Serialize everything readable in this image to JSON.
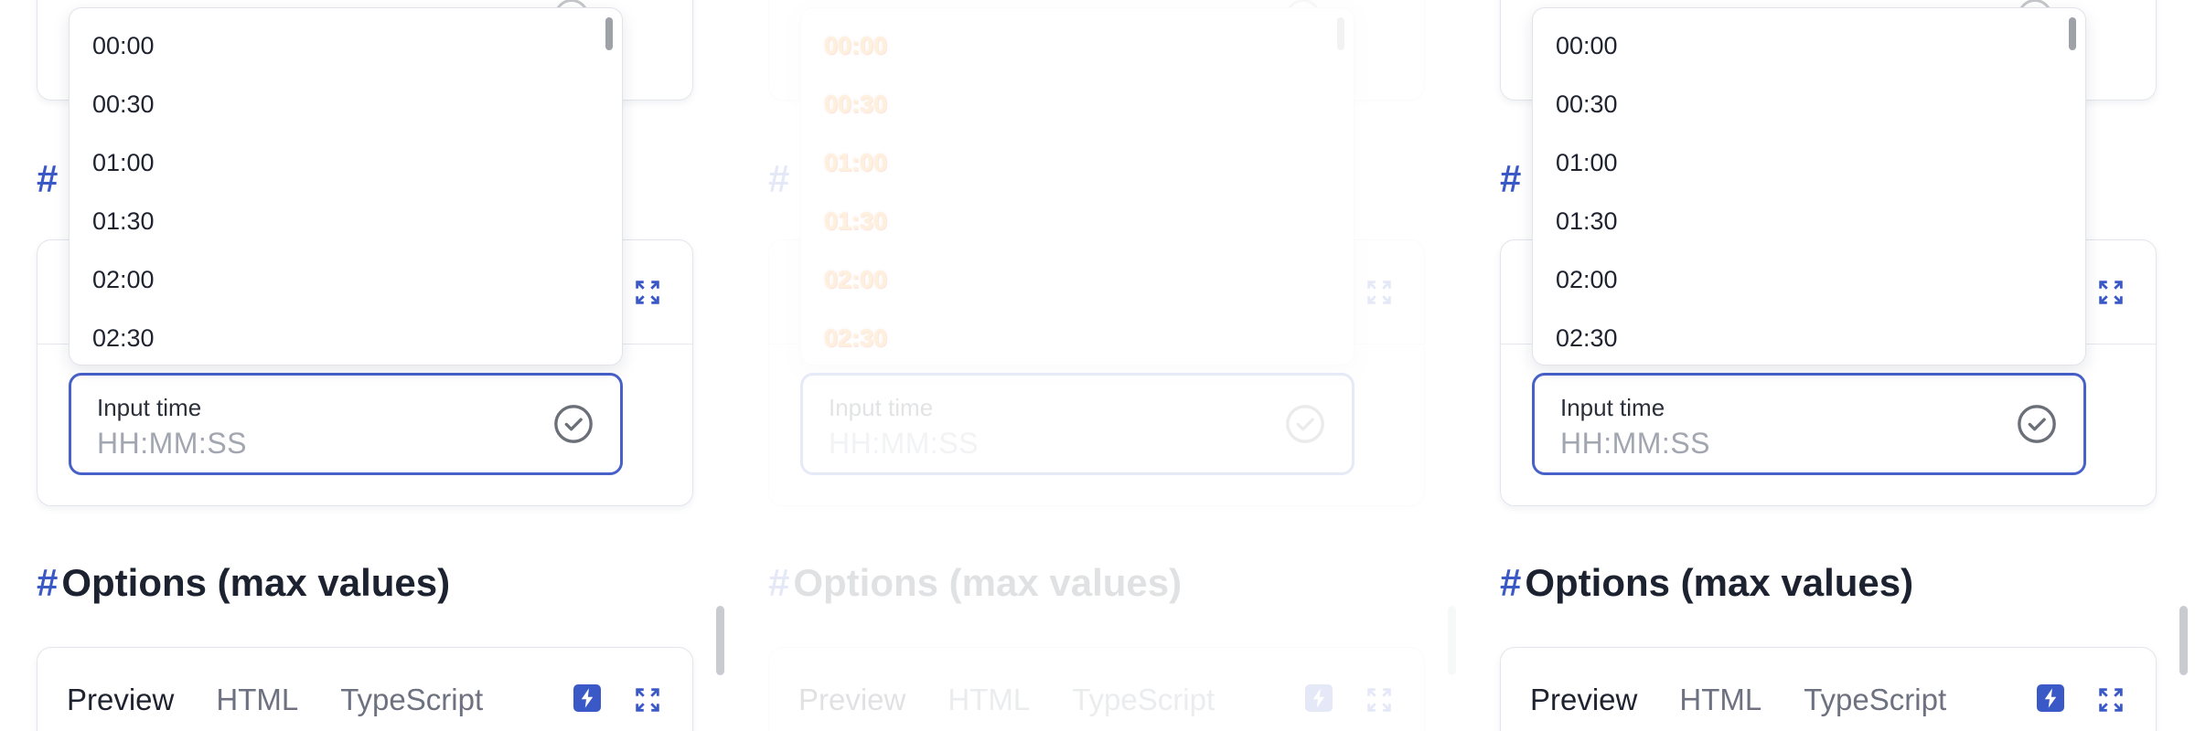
{
  "headings": {
    "partial_hash": "#",
    "options_hash": "#",
    "options_title": "Options (max values)"
  },
  "tabs": {
    "preview": "Preview",
    "html": "HTML",
    "typescript": "TypeScript"
  },
  "time_input": {
    "label": "Input time",
    "placeholder": "HH:MM:SS"
  },
  "dropdown": {
    "options": [
      "00:00",
      "00:30",
      "01:00",
      "01:30",
      "02:00",
      "02:30"
    ]
  },
  "colors": {
    "accent": "#3b58c7",
    "input_border": "#4861c9"
  },
  "icons": {
    "expand": "expand-icon",
    "bolt": "bolt-icon",
    "check": "check-circle-icon"
  }
}
